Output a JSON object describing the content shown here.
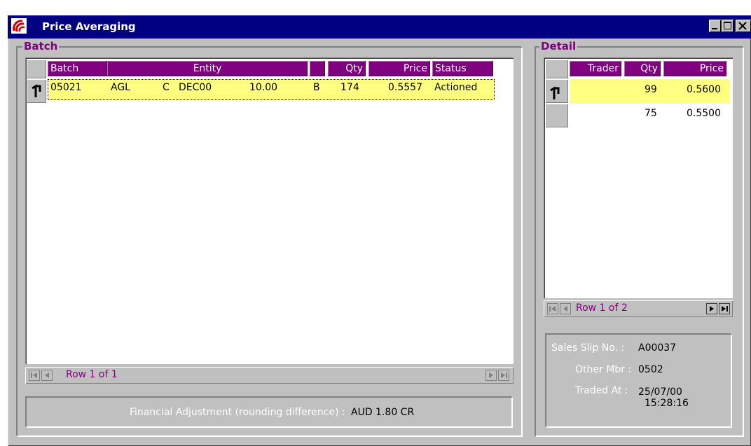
{
  "window": {
    "title": "Price Averaging"
  },
  "batch": {
    "legend": "Batch",
    "columns": [
      "Batch",
      "Entity",
      "",
      "Qty",
      "Price",
      "Status"
    ],
    "rows": [
      {
        "batch": "05021",
        "code": "AGL",
        "type": "C",
        "expiry": "DEC00",
        "strike": "10.00",
        "side": "B",
        "qty": "174",
        "price": "0.5557",
        "status": "Actioned"
      }
    ],
    "nav": {
      "text": "Row 1 of 1"
    },
    "adjustment": {
      "label": "Financial Adjustment (rounding difference) :",
      "value": "AUD 1.80 CR"
    }
  },
  "detail": {
    "legend": "Detail",
    "columns": [
      "Trader",
      "Qty",
      "Price"
    ],
    "rows": [
      {
        "trader": "",
        "qty": "99",
        "price": "0.5600"
      },
      {
        "trader": "",
        "qty": "75",
        "price": "0.5500"
      }
    ],
    "nav": {
      "text": "Row 1 of 2"
    },
    "info": {
      "slip_label": "Sales Slip No. :",
      "slip_value": "A00037",
      "mbr_label": "Other Mbr :",
      "mbr_value": "0502",
      "traded_label": "Traded At :",
      "traded_date": "25/07/00",
      "traded_time": "15:28:16"
    }
  },
  "colors": {
    "titlebar": "#000080",
    "header": "#800080",
    "highlight": "#ffff80",
    "face": "#c0c0c0"
  }
}
